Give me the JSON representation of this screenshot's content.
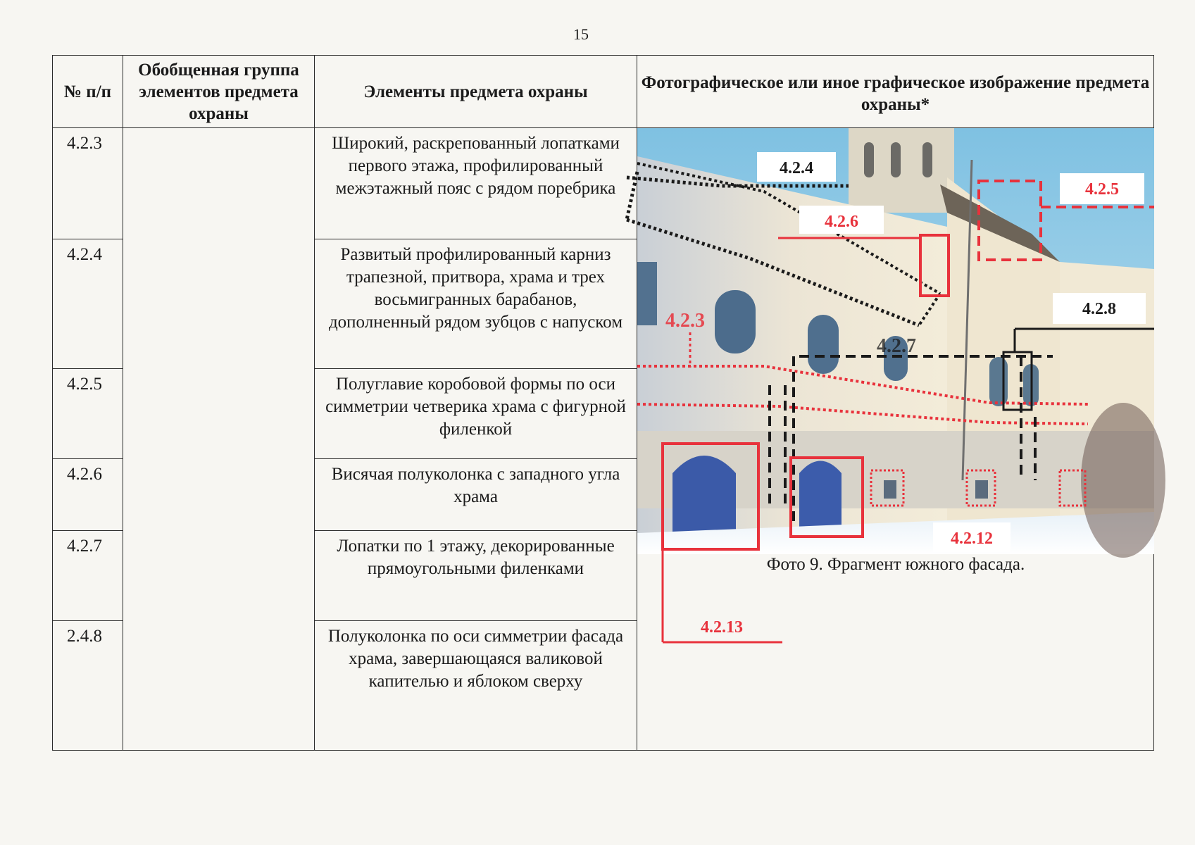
{
  "page_number": "15",
  "table": {
    "headers": {
      "num": "№ п/п",
      "group": "Обобщенная группа элементов предмета охраны",
      "elements": "Элементы предмета охраны",
      "photo": "Фотографическое или иное графическое изображение предмета охраны*"
    },
    "rows": [
      {
        "num": "4.2.3",
        "element": "Широкий, раскрепованный лопатками первого этажа, профилированный межэтажный пояс с рядом поребрика"
      },
      {
        "num": "4.2.4",
        "element": "Развитый профилированный карниз трапезной, притвора, храма и трех восьмигранных барабанов, дополненный рядом зубцов с напуском"
      },
      {
        "num": "4.2.5",
        "element": "Полуглавие коробовой формы по оси симметрии четверика храма с фигурной филенкой"
      },
      {
        "num": "4.2.6",
        "element": "Висячая полуколонка с западного угла храма"
      },
      {
        "num": "4.2.7",
        "element": "Лопатки по 1 этажу, декорированные прямоугольными филенками"
      },
      {
        "num": "2.4.8",
        "element": "Полуколонка по оси симметрии фасада храма, завершающаяся валиковой капителью и яблоком сверху"
      }
    ]
  },
  "photo": {
    "caption": "Фото 9. Фрагмент южного фасада.",
    "labels": {
      "l423": "4.2.3",
      "l424": "4.2.4",
      "l425": "4.2.5",
      "l426": "4.2.6",
      "l427": "4.2.7",
      "l428": "4.2.8",
      "l4212": "4.2.12",
      "l4213": "4.2.13"
    },
    "colors": {
      "marker_red": "#e8323c",
      "marker_black": "#1a1a1a",
      "sky": "#8ec9e6",
      "wall": "#e9e2d2",
      "door": "#3b5aa8"
    }
  }
}
